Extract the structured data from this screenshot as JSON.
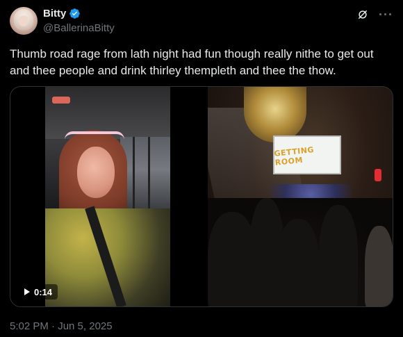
{
  "post": {
    "author": {
      "display_name": "Bitty",
      "handle": "@BallerinaBitty",
      "verified": true
    },
    "text": "Thumb road rage from lath night had fun though really nithe to get out and thee people and drink thirley thempleth and thee the thow.",
    "media": {
      "video_duration": "0:14",
      "right_image_sign_text": "GETTING ROOM"
    },
    "timestamp": "5:02 PM · Jun 5, 2025"
  },
  "icons": {
    "verified": "verified-badge-icon",
    "grok": "grok-icon",
    "more": "more-icon",
    "play": "play-icon"
  },
  "colors": {
    "background": "#000000",
    "text_primary": "#e7e9ea",
    "text_secondary": "#71767b",
    "verified_blue": "#1d9bf0",
    "border": "#2f3336"
  }
}
